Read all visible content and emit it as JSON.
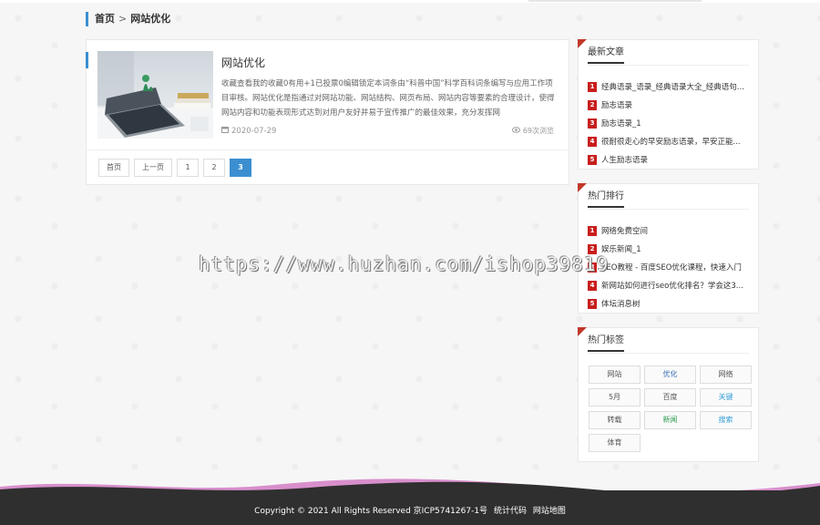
{
  "breadcrumb": {
    "home": "首页",
    "separator": ">",
    "current": "网站优化"
  },
  "article": {
    "title": "网站优化",
    "excerpt": "收藏查看我的收藏0有用+1已投票0编辑锁定本词条由“科普中国”科学百科词条编写与应用工作项目审核。网站优化是指通过对网站功能、网站结构、网页布局、网站内容等要素的合理设计，使得网站内容和功能表现形式达到对用户友好并易于宣传推广的最佳效果，充分发挥网",
    "date": "2020-07-29",
    "views": "69次浏览"
  },
  "pager": {
    "items": [
      {
        "label": "首页",
        "active": false
      },
      {
        "label": "上一页",
        "active": false
      },
      {
        "label": "1",
        "active": false
      },
      {
        "label": "2",
        "active": false
      },
      {
        "label": "3",
        "active": true
      }
    ]
  },
  "latest": {
    "title": "最新文章",
    "items": [
      {
        "num": "1",
        "text": "经典语录_语录_经典语录大全_经典语句..."
      },
      {
        "num": "2",
        "text": "励志语录"
      },
      {
        "num": "3",
        "text": "励志语录_1"
      },
      {
        "num": "4",
        "text": "很耐很走心的早安励志语录，早安正能..."
      },
      {
        "num": "5",
        "text": "人生励志语录"
      }
    ]
  },
  "hot": {
    "title": "热门排行",
    "items": [
      {
        "num": "1",
        "text": "网络免费空间"
      },
      {
        "num": "2",
        "text": "娱乐新闻_1"
      },
      {
        "num": "3",
        "text": "SEO教程 - 百度SEO优化课程，快速入门"
      },
      {
        "num": "4",
        "text": "新网站如何进行seo优化排名？学会这3..."
      },
      {
        "num": "5",
        "text": "体坛消息树"
      }
    ]
  },
  "tags": {
    "title": "热门标签",
    "items": [
      {
        "label": "网站",
        "color": "#555555"
      },
      {
        "label": "优化",
        "color": "#3b6fb6"
      },
      {
        "label": "网络",
        "color": "#555555"
      },
      {
        "label": "5月",
        "color": "#555555"
      },
      {
        "label": "百度",
        "color": "#555555"
      },
      {
        "label": "关键",
        "color": "#3aa0d8"
      },
      {
        "label": "转载",
        "color": "#555555"
      },
      {
        "label": "新闻",
        "color": "#2e9d4f"
      },
      {
        "label": "搜索",
        "color": "#3aa0d8"
      },
      {
        "label": "体育",
        "color": "#555555"
      }
    ]
  },
  "watermark": "https://www.huzhan.com/ishop39819",
  "footer": {
    "copyright": "Copyright © 2021 All Rights Reserved 京ICP5741267-1号",
    "stats": "统计代码",
    "sitemap": "网站地图"
  },
  "colors": {
    "accent": "#3b8fd1",
    "rank_badge": "#c81e1e",
    "footer_bg": "#2f2f2f"
  }
}
